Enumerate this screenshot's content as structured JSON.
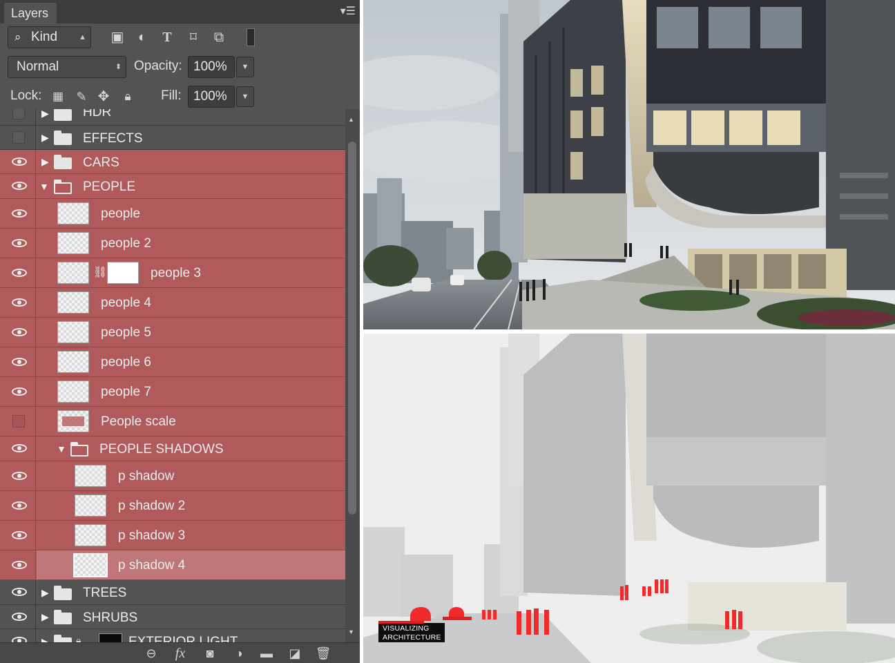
{
  "panel": {
    "tab_title": "Layers",
    "filter_kind": "Kind",
    "blend_mode": "Normal",
    "opacity_label": "Opacity:",
    "opacity_value": "100%",
    "lock_label": "Lock:",
    "fill_label": "Fill:",
    "fill_value": "100%",
    "filter_icons": [
      "image-filter-icon",
      "adjustment-filter-icon",
      "type-filter-icon",
      "shape-filter-icon",
      "smart-object-filter-icon",
      "filter-toggle-icon"
    ],
    "lock_icons": [
      "lock-transparent-icon",
      "lock-image-icon",
      "lock-position-icon",
      "lock-all-icon"
    ],
    "footer_icons": [
      "link-layers-icon",
      "fx-icon",
      "add-mask-icon",
      "adjustment-layer-icon",
      "new-group-icon",
      "new-layer-icon",
      "trash-icon"
    ],
    "footer_fx": "fx"
  },
  "layers": [
    {
      "name": "HDR",
      "kind": "group",
      "visible": false,
      "selected": false
    },
    {
      "name": "EFFECTS",
      "kind": "group",
      "visible": false,
      "selected": false
    },
    {
      "name": "CARS",
      "kind": "group",
      "visible": true,
      "selected": true
    },
    {
      "name": "PEOPLE",
      "kind": "group-open",
      "visible": true,
      "selected": true
    },
    {
      "name": "people",
      "kind": "layer",
      "visible": true,
      "selected": true
    },
    {
      "name": "people 2",
      "kind": "layer",
      "visible": true,
      "selected": true
    },
    {
      "name": "people 3",
      "kind": "masked",
      "visible": true,
      "selected": true
    },
    {
      "name": "people 4",
      "kind": "layer",
      "visible": true,
      "selected": true
    },
    {
      "name": "people 5",
      "kind": "layer",
      "visible": true,
      "selected": true
    },
    {
      "name": "people 6",
      "kind": "layer",
      "visible": true,
      "selected": true
    },
    {
      "name": "people 7",
      "kind": "layer",
      "visible": true,
      "selected": true
    },
    {
      "name": "People scale",
      "kind": "layer-scale",
      "visible": false,
      "selected": true
    },
    {
      "name": "PEOPLE SHADOWS",
      "kind": "subgroup-open",
      "visible": true,
      "selected": true
    },
    {
      "name": "p shadow",
      "kind": "sublayer",
      "visible": true,
      "selected": true
    },
    {
      "name": "p shadow 2",
      "kind": "sublayer",
      "visible": true,
      "selected": true
    },
    {
      "name": "p shadow 3",
      "kind": "sublayer",
      "visible": true,
      "selected": true
    },
    {
      "name": "p shadow 4",
      "kind": "sublayer-active",
      "visible": true,
      "selected": true
    },
    {
      "name": "TREES",
      "kind": "group",
      "visible": true,
      "selected": false
    },
    {
      "name": "SHRUBS",
      "kind": "group",
      "visible": true,
      "selected": false
    },
    {
      "name": "EXTERIOR LIGHT",
      "kind": "group-smart",
      "visible": true,
      "selected": false
    }
  ],
  "renders": {
    "top_alt": "full color street render",
    "bottom_alt": "washed out render with people highlighted in red",
    "logo_line1": "VISUALIZING",
    "logo_line2": "ARCHITECTURE",
    "highlight_color": "#ef2b2b"
  }
}
